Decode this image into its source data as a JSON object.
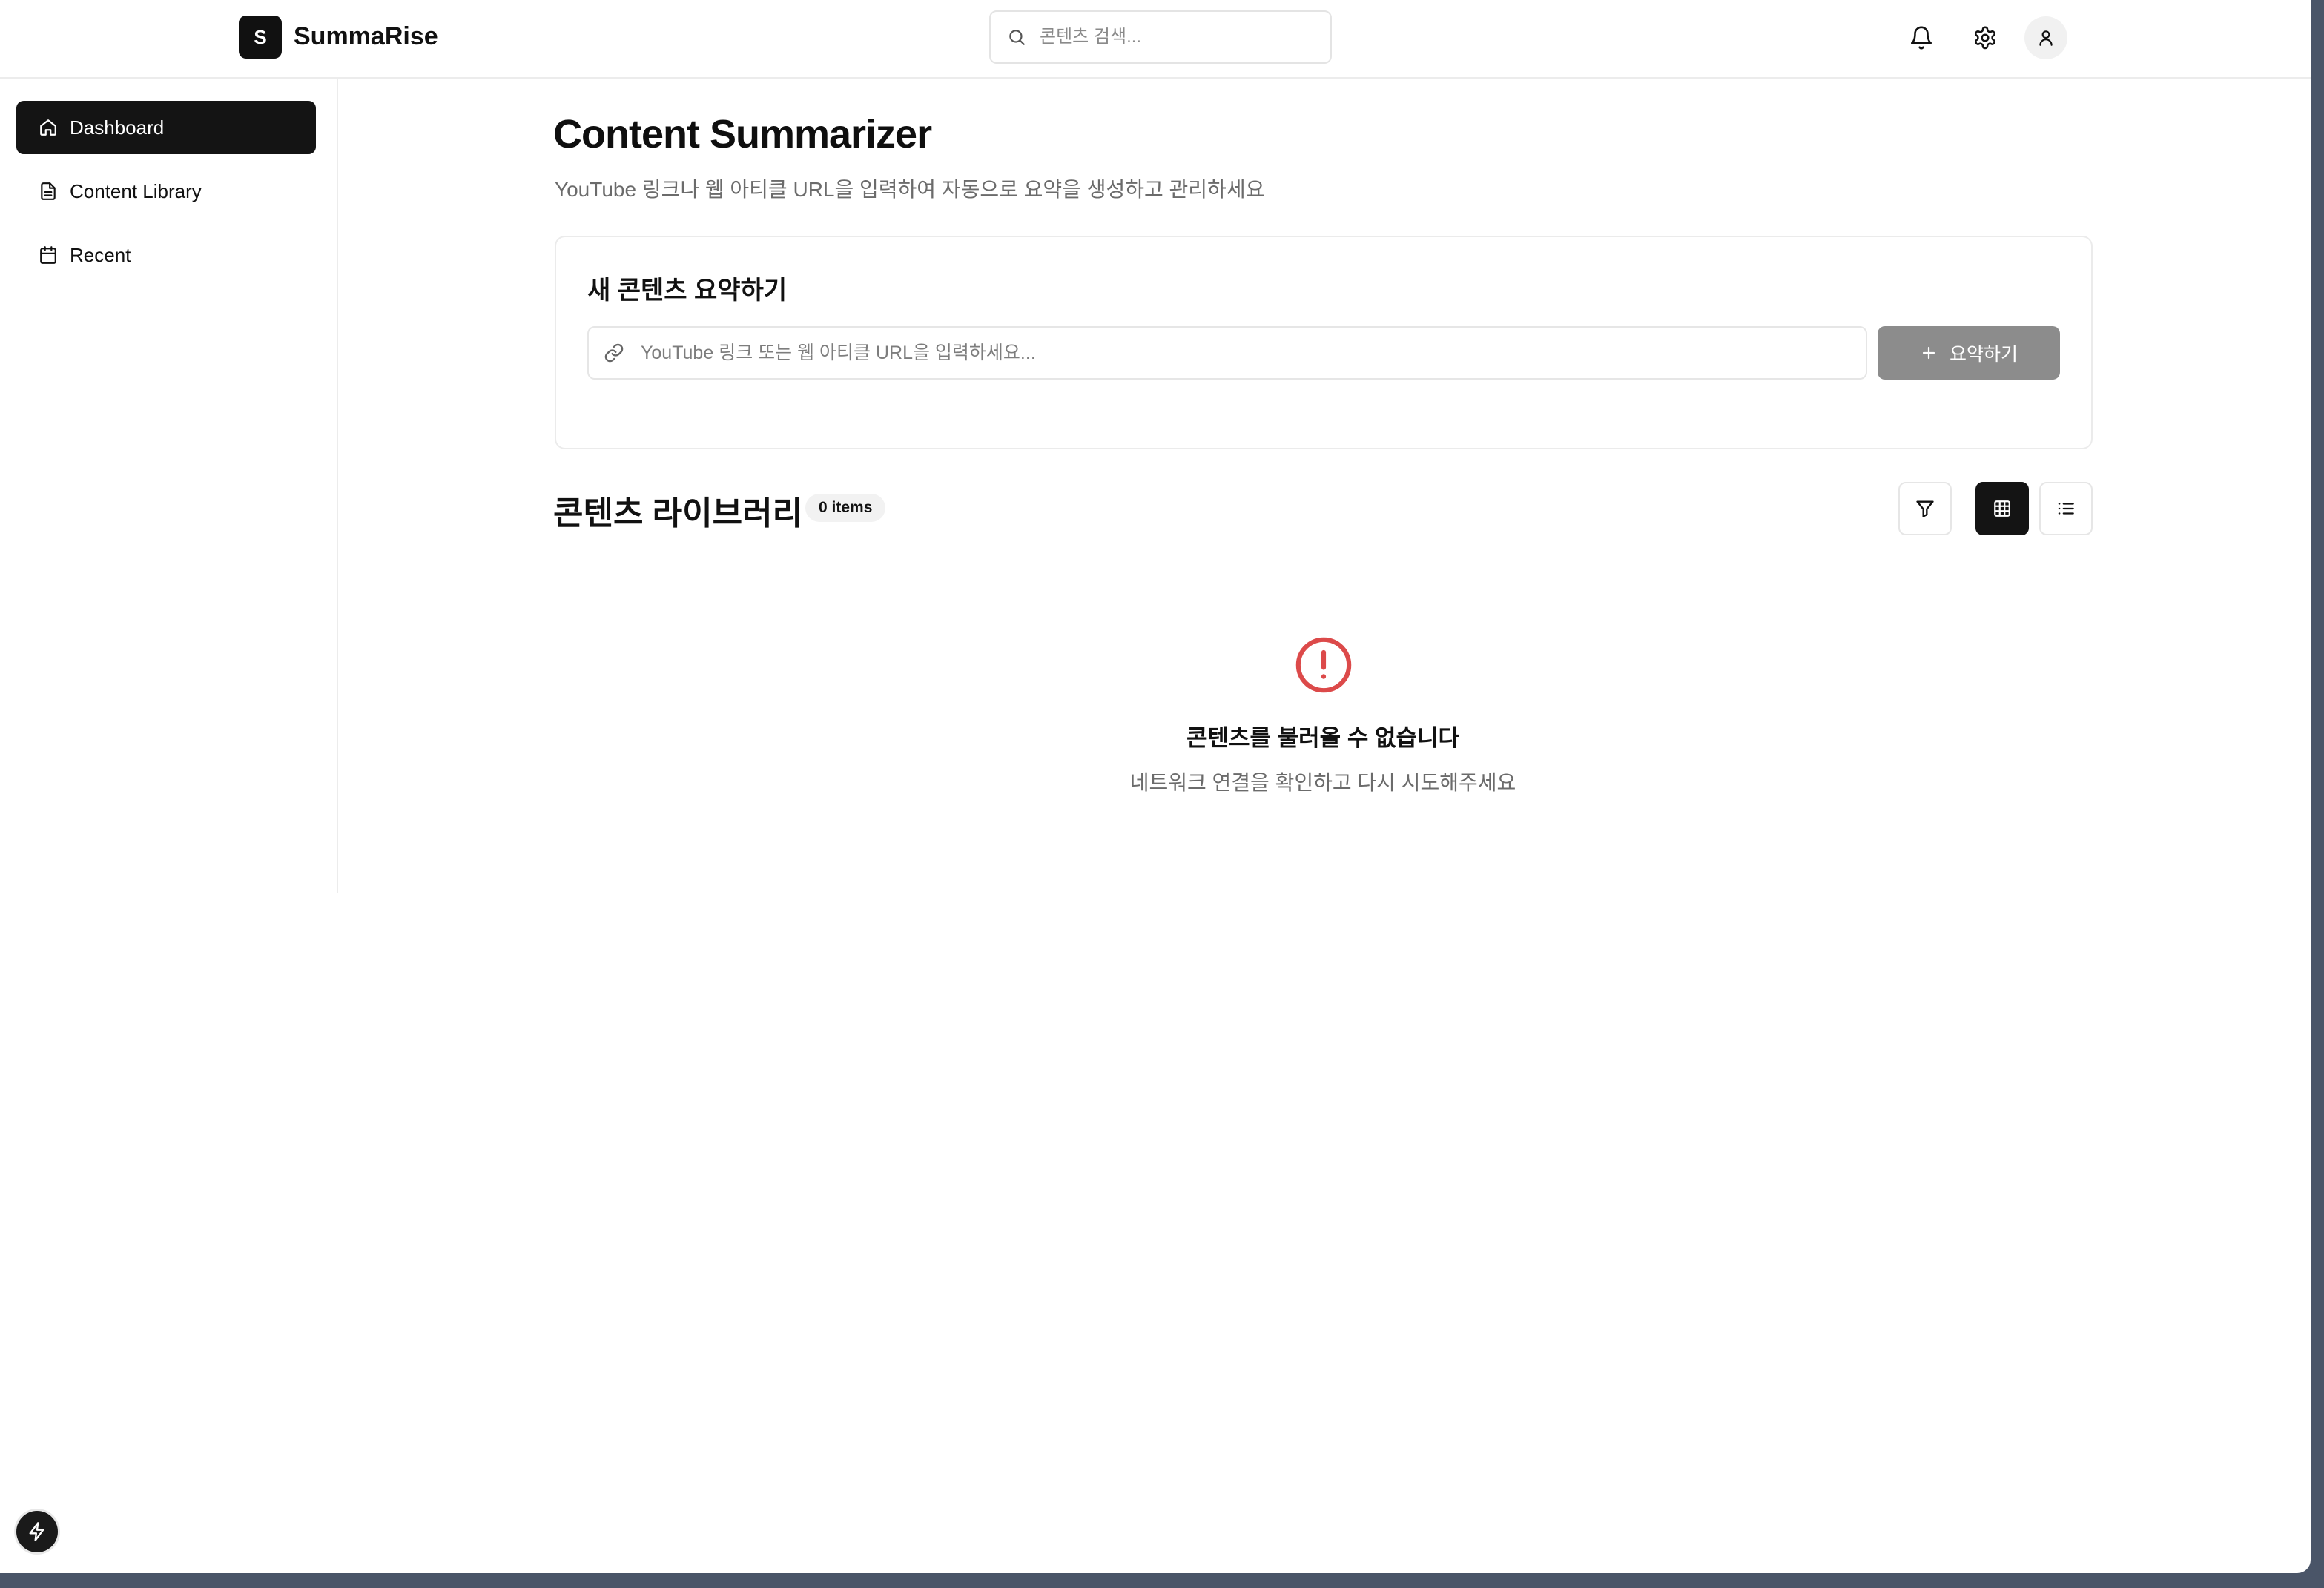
{
  "header": {
    "logo_letter": "S",
    "brand": "SummaRise",
    "search_placeholder": "콘텐츠 검색...",
    "icons": [
      "bell-icon",
      "gear-icon",
      "user-icon"
    ]
  },
  "sidebar": {
    "items": [
      {
        "label": "Dashboard",
        "icon": "home-icon",
        "active": true
      },
      {
        "label": "Content Library",
        "icon": "document-icon",
        "active": false
      },
      {
        "label": "Recent",
        "icon": "calendar-icon",
        "active": false
      }
    ]
  },
  "main": {
    "title": "Content Summarizer",
    "subtitle": "YouTube 링크나 웹 아티클 URL을 입력하여 자동으로 요약을 생성하고 관리하세요",
    "new_card": {
      "title": "새 콘텐츠 요약하기",
      "url_placeholder": "YouTube 링크 또는 웹 아티클 URL을 입력하세요...",
      "url_value": "",
      "button_label": "요약하기"
    },
    "library": {
      "title": "콘텐츠 라이브러리",
      "count_badge": "0 items",
      "view_mode": "grid"
    },
    "error": {
      "title": "콘텐츠를 불러올 수 없습니다",
      "message": "네트워크 연결을 확인하고 다시 시도해주세요"
    }
  },
  "colors": {
    "primary": "#141414",
    "button_disabled": "#8c8c8c",
    "error": "#dc4a4a",
    "muted_text": "#6b6b6b",
    "frame": "#4a5568"
  }
}
